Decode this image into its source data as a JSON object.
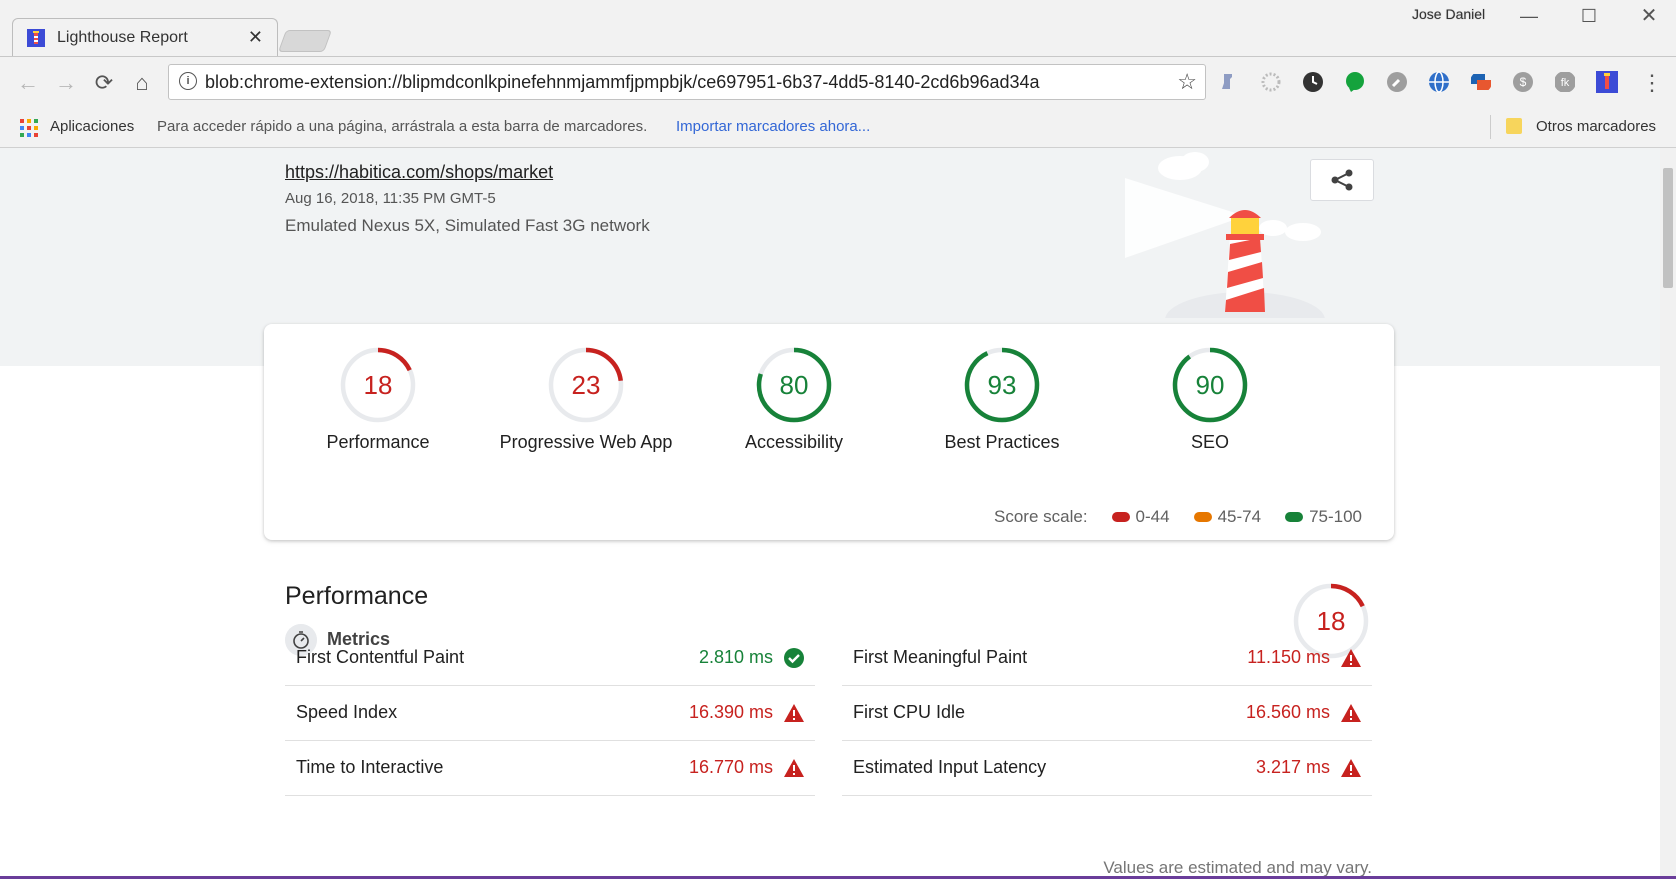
{
  "browser": {
    "tab_title": "Lighthouse Report",
    "tab_close": "✕",
    "profile_name": "Jose Daniel",
    "window_controls": {
      "minimize": "—",
      "maximize": "☐",
      "close": "✕"
    },
    "address_bar": {
      "url": "blob:chrome-extension://blipmdconlkpinefehnmjammfjpmpbjk/ce697951-6b37-4dd5-8140-2cd6b96ad34a",
      "info_icon": "i",
      "star": "☆"
    },
    "nav": {
      "back": "←",
      "forward": "→",
      "reload": "⟳",
      "home": "⌂"
    },
    "bookmarks": {
      "apps_label": "Aplicaciones",
      "hint": "Para acceder rápido a una página, arrástrala a esta barra de marcadores.",
      "import_link": "Importar marcadores ahora...",
      "other_label": "Otros marcadores"
    },
    "extensions": [
      "flask-icon",
      "gear-dotted-icon",
      "clock-icon",
      "chat-icon",
      "wrench-icon",
      "globe-icon",
      "screens-icon",
      "coin-icon",
      "fk-icon",
      "lighthouse-icon"
    ]
  },
  "report": {
    "url": "https://habitica.com/shops/market",
    "date": "Aug 16, 2018, 11:35 PM GMT-5",
    "environment": "Emulated Nexus 5X, Simulated Fast 3G network",
    "categories": [
      {
        "label": "Performance",
        "score": "18",
        "value": 18,
        "status": "fail"
      },
      {
        "label": "Progressive Web App",
        "score": "23",
        "value": 23,
        "status": "fail"
      },
      {
        "label": "Accessibility",
        "score": "80",
        "value": 80,
        "status": "pass"
      },
      {
        "label": "Best Practices",
        "score": "93",
        "value": 93,
        "status": "pass"
      },
      {
        "label": "SEO",
        "score": "90",
        "value": 90,
        "status": "pass"
      }
    ],
    "score_scale": {
      "label": "Score scale:",
      "ranges": [
        "0-44",
        "45-74",
        "75-100"
      ]
    },
    "performance": {
      "title": "Performance",
      "score": "18",
      "value": 18,
      "metrics_title": "Metrics",
      "metrics": [
        {
          "name": "First Contentful Paint",
          "value": "2.810 ms",
          "status": "pass"
        },
        {
          "name": "First Meaningful Paint",
          "value": "11.150 ms",
          "status": "fail"
        },
        {
          "name": "Speed Index",
          "value": "16.390 ms",
          "status": "fail"
        },
        {
          "name": "First CPU Idle",
          "value": "16.560 ms",
          "status": "fail"
        },
        {
          "name": "Time to Interactive",
          "value": "16.770 ms",
          "status": "fail"
        },
        {
          "name": "Estimated Input Latency",
          "value": "3.217 ms",
          "status": "fail"
        }
      ],
      "footnote": "Values are estimated and may vary."
    },
    "colors": {
      "fail": "#c7221f",
      "average": "#e67700",
      "pass": "#178239"
    }
  }
}
